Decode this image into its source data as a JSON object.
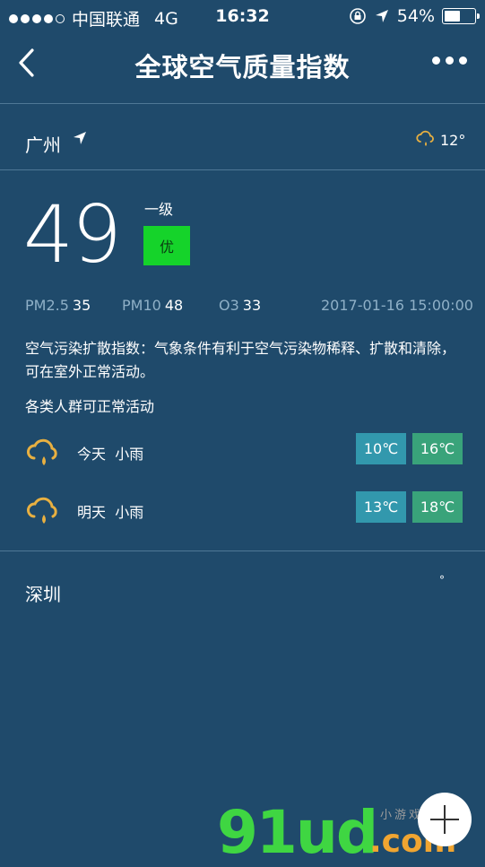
{
  "status_bar": {
    "carrier": "中国联通",
    "network": "4G",
    "time": "16:32",
    "battery": "54%",
    "battery_level": 0.54,
    "signal_bars_filled": 4,
    "signal_bars_total": 5
  },
  "nav": {
    "title": "全球空气质量指数"
  },
  "city": {
    "name": "广州",
    "weather_temp": "12°"
  },
  "aqi": {
    "value": "49",
    "level": "一级",
    "quality": "优"
  },
  "pollutants": {
    "pm25_label": "PM2.5",
    "pm25_value": "35",
    "pm10_label": "PM10",
    "pm10_value": "48",
    "o3_label": "O3",
    "o3_value": "33",
    "timestamp": "2017-01-16 15:00:00"
  },
  "description": "空气污染扩散指数：气象条件有利于空气污染物稀释、扩散和清除，可在室外正常活动。",
  "advice": "各类人群可正常活动",
  "forecast": [
    {
      "day": "今天",
      "weather": "小雨",
      "min": "10℃",
      "max": "16℃"
    },
    {
      "day": "明天",
      "weather": "小雨",
      "min": "13℃",
      "max": "18℃"
    }
  ],
  "city2": {
    "name": "深圳",
    "temp": "°"
  },
  "watermark": {
    "main": "91ud",
    "com": ".com",
    "small": "小游戏商店"
  },
  "colors": {
    "background": "#1f4a6b",
    "badge_good": "#15d32a",
    "temp_min": "#3298ad",
    "temp_max": "#39a37a",
    "weather_icon": "#e8b041"
  }
}
